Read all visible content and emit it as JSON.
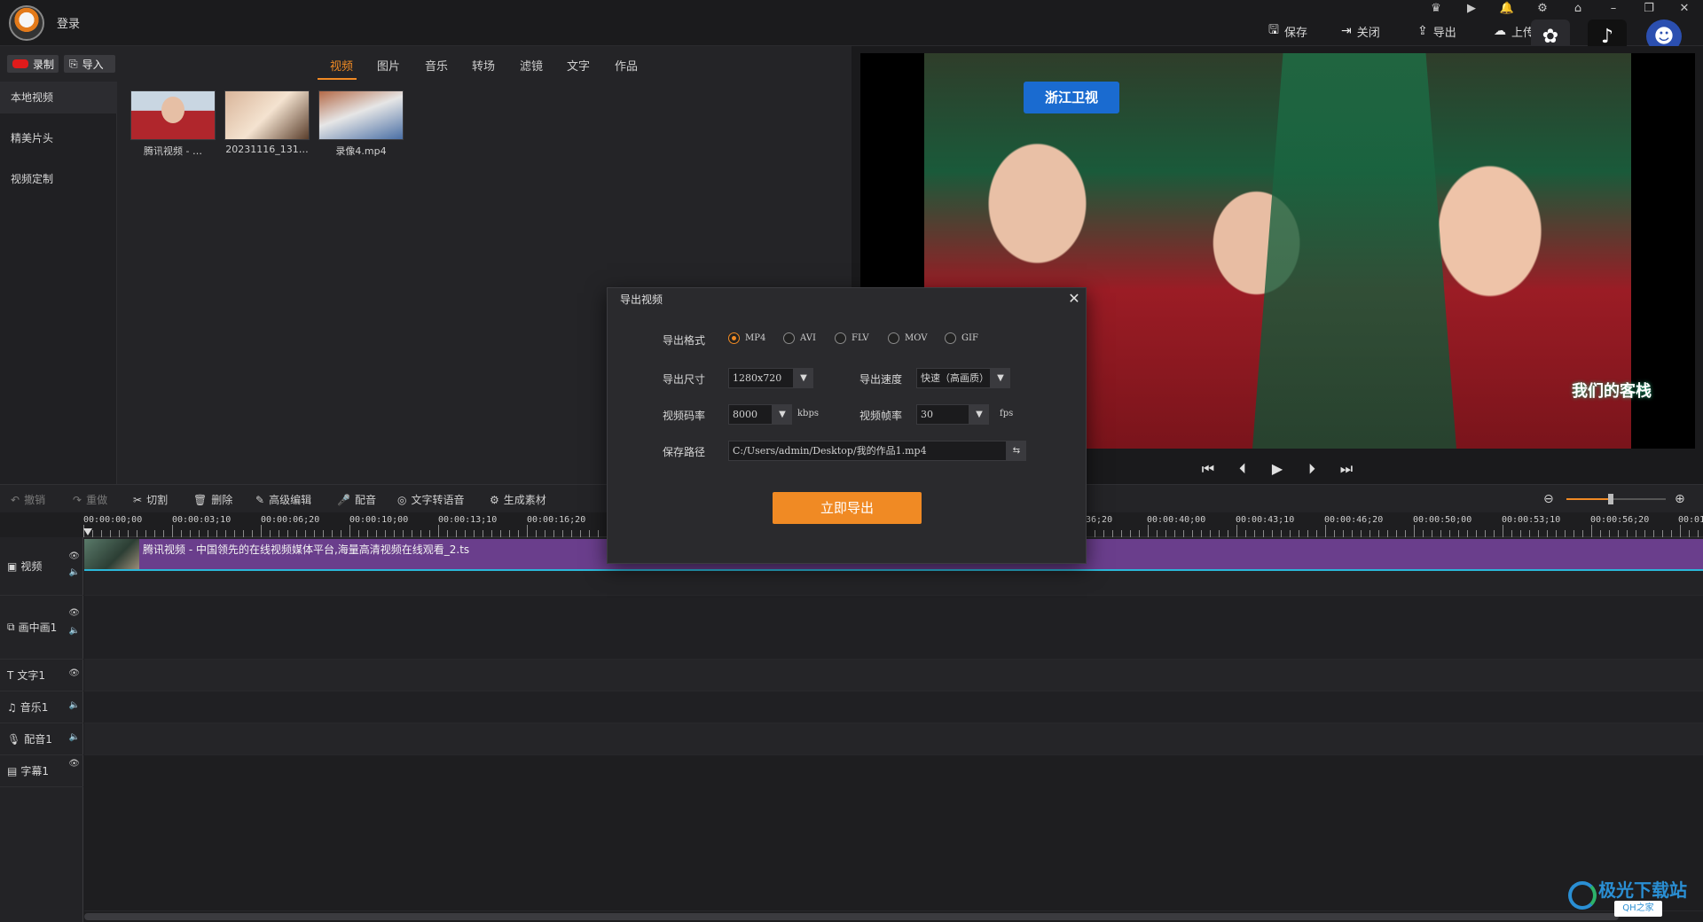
{
  "header": {
    "login": "登录",
    "save": "保存",
    "close": "关闭",
    "export": "导出",
    "upload": "上传"
  },
  "media": {
    "record": "录制",
    "import": "导入",
    "tabs": [
      "视频",
      "图片",
      "音乐",
      "转场",
      "滤镜",
      "文字",
      "作品"
    ],
    "active_tab": "视频",
    "sidebar": [
      "本地视频",
      "精美片头",
      "视频定制"
    ],
    "files": [
      "腾讯视频 - …",
      "20231116_131…",
      "录像4.mp4"
    ]
  },
  "preview": {
    "channel": "浙江卫视",
    "show_title": "我们的客栈"
  },
  "toolbar": {
    "undo": "撤销",
    "redo": "重做",
    "cut": "切割",
    "delete": "删除",
    "advanced_edit": "高级编辑",
    "dub": "配音",
    "text_to_speech": "文字转语音",
    "generate": "生成素材"
  },
  "timeline": {
    "ticks": [
      "00:00:00;00",
      "00:00:03;10",
      "00:00:06;20",
      "00:00:10;00",
      "00:00:13;10",
      "00:00:16;20",
      "36;20",
      "00:00:40;00",
      "00:00:43;10",
      "00:00:46;20",
      "00:00:50;00",
      "00:00:53;10",
      "00:00:56;20",
      "00:01"
    ],
    "tracks": [
      "视频",
      "画中画1",
      "文字1",
      "音乐1",
      "配音1",
      "字幕1"
    ],
    "clip_label": "腾讯视频 - 中国领先的在线视频媒体平台,海量高清视频在线观看_2.ts"
  },
  "export_dialog": {
    "title": "导出视频",
    "format_label": "导出格式",
    "formats": [
      "MP4",
      "AVI",
      "FLV",
      "MOV",
      "GIF"
    ],
    "selected_format": "MP4",
    "size_label": "导出尺寸",
    "size_value": "1280x720",
    "speed_label": "导出速度",
    "speed_value": "快速（高画质）",
    "bitrate_label": "视频码率",
    "bitrate_value": "8000",
    "bitrate_unit": "kbps",
    "fps_label": "视频帧率",
    "fps_value": "30",
    "fps_unit": "fps",
    "path_label": "保存路径",
    "path_value": "C:/Users/admin/Desktop/我的作品1.mp4",
    "export_button": "立即导出"
  },
  "watermark": {
    "site": "极光下载站",
    "badge": "QH之家"
  },
  "colors": {
    "accent": "#f08a24",
    "clip": "#6a3e8c",
    "playline": "#2bb7d9"
  }
}
